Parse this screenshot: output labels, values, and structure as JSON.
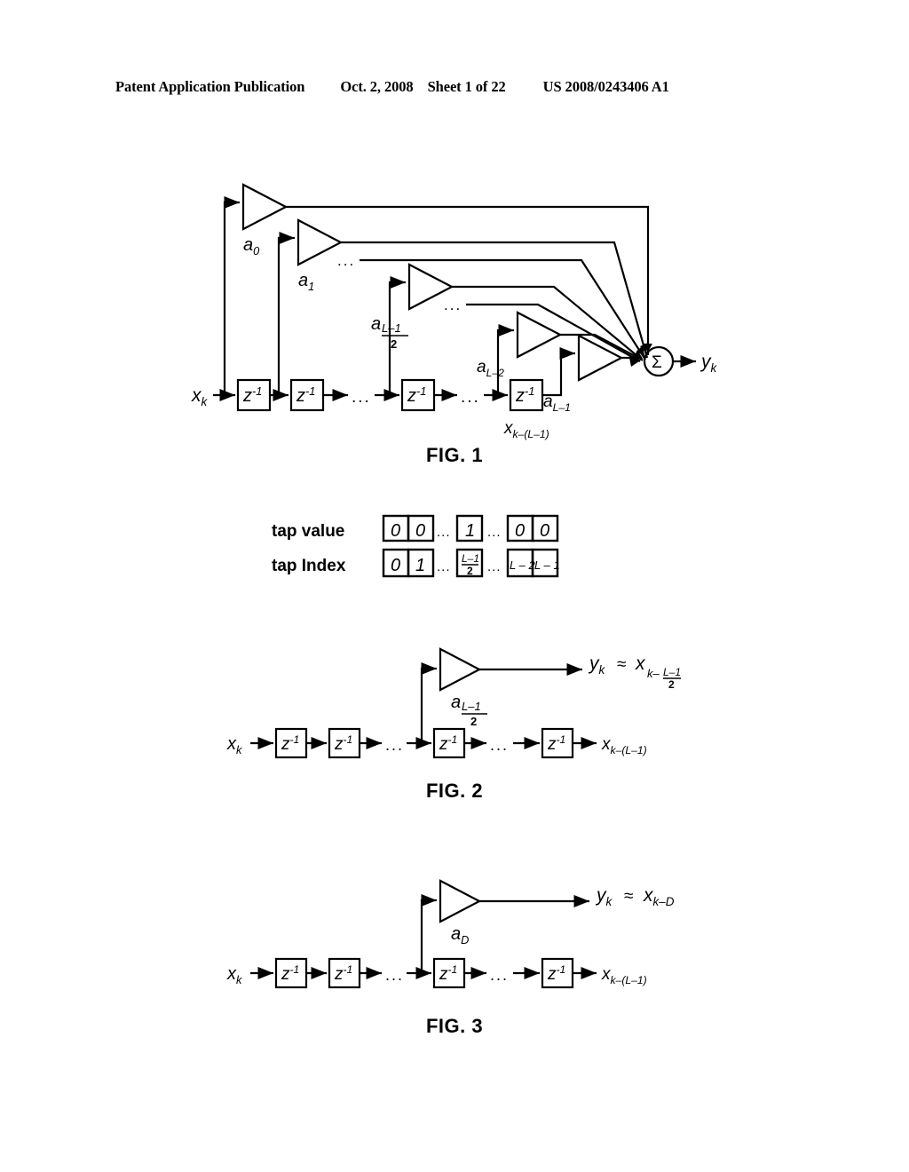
{
  "header": {
    "publication": "Patent Application Publication",
    "date": "Oct. 2, 2008",
    "sheet": "Sheet 1 of 22",
    "patent_number": "US 2008/0243406 A1"
  },
  "captions": {
    "fig1": "FIG. 1",
    "fig2": "FIG. 2",
    "fig3": "FIG. 3"
  },
  "figure1": {
    "input_label": "x",
    "input_sub": "k",
    "output_label": "y",
    "output_sub": "k",
    "sum_symbol": "Σ",
    "delay_label": "z",
    "delay_exp": "-1",
    "ellipsis": "...",
    "coefficients": [
      {
        "base": "a",
        "sub": "0"
      },
      {
        "base": "a",
        "sub": "1"
      },
      {
        "base": "a",
        "sub_num": "L–1",
        "sub_den": "2"
      },
      {
        "base": "a",
        "sub": "L–2"
      },
      {
        "base": "a",
        "sub": "L–1"
      }
    ],
    "last_tap_label": "x",
    "last_tap_sub": "k–(L–1)"
  },
  "figure1b": {
    "row_labels": [
      "tap value",
      "tap Index"
    ],
    "tap_values": [
      "0",
      "0",
      "...",
      "1",
      "...",
      "0",
      "0"
    ],
    "tap_indices": [
      "0",
      "1",
      "...",
      "(L-1)/2",
      "...",
      "L – 2",
      "L – 1"
    ],
    "tap_index_fraction": {
      "num": "L–1",
      "den": "2"
    }
  },
  "figure2": {
    "input_label": "x",
    "input_sub": "k",
    "delay_label": "z",
    "delay_exp": "-1",
    "ellipsis": "...",
    "coefficient": {
      "base": "a",
      "sub_num": "L–1",
      "sub_den": "2"
    },
    "output_label": "y",
    "output_sub": "k",
    "approx": "≈",
    "output_expr_base": "x",
    "output_expr_sub": "k–",
    "output_expr_num": "L–1",
    "output_expr_den": "2",
    "last_tap_label": "x",
    "last_tap_sub": "k–(L–1)"
  },
  "figure3": {
    "input_label": "x",
    "input_sub": "k",
    "delay_label": "z",
    "delay_exp": "-1",
    "ellipsis": "...",
    "coefficient": {
      "base": "a",
      "sub": "D"
    },
    "output_label": "y",
    "output_sub": "k",
    "approx": "≈",
    "output_expr_base": "x",
    "output_expr_sub": "k–D",
    "last_tap_label": "x",
    "last_tap_sub": "k–(L–1)"
  },
  "colors": {
    "ink": "#000000",
    "paper": "#ffffff"
  }
}
